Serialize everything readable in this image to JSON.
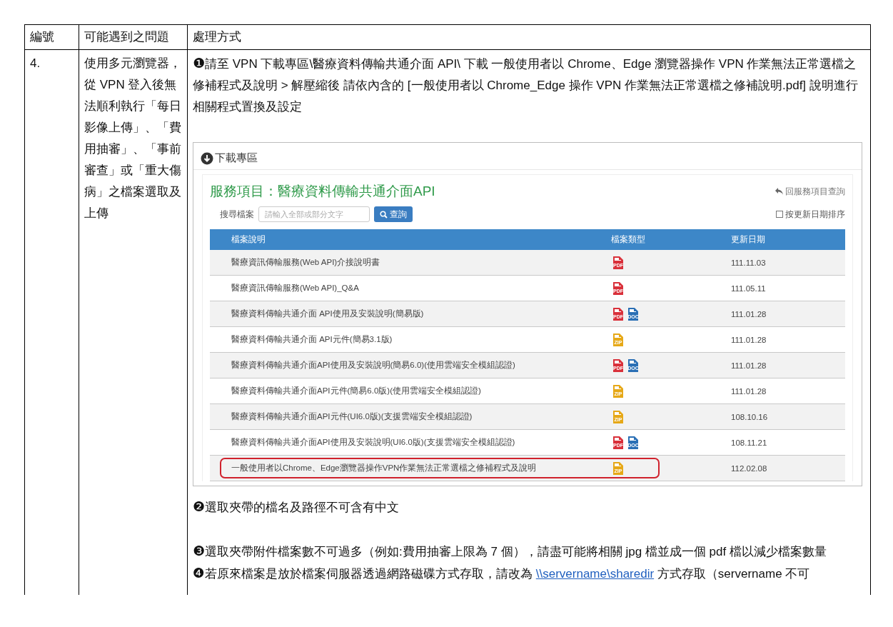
{
  "table": {
    "columns": [
      "編號",
      "可能遇到之問題",
      "處理方式"
    ],
    "rows": [
      {
        "number": "4.",
        "problem": "使用多元瀏覽器，從 VPN 登入後無法順利執行「每日影像上傳」、「費用抽審」、「事前審查」或「重大傷病」之檔案選取及上傳",
        "steps": [
          {
            "marker": "❶",
            "parts": [
              {
                "kind": "text",
                "text": "請至  VPN 下載專區\\醫療資料傳輸共通介面 API\\  下載  一般使用者以 Chrome、Edge 瀏覽器操作 VPN 作業無法正常選檔之修補程式及說明  >  解壓縮後  請依內含的  [一般使用者以 Chrome_Edge 操作 VPN 作業無法正常選檔之修補說明.pdf]  說明進行相關程式置換及設定"
              }
            ],
            "screenshot": {
              "section_title": "下載專區",
              "service_title": "服務項目：醫療資料傳輸共通介面API",
              "back_link": "回服務項目查詢",
              "search_label": "搜尋檔案",
              "search_placeholder": "請輸入全部或部分文字",
              "search_button": "查詢",
              "sort_option": {
                "label": "按更新日期排序",
                "checked": false
              },
              "columns": [
                "檔案說明",
                "檔案類型",
                "更新日期"
              ],
              "files": [
                {
                  "name": "醫療資訊傳輸服務(Web API)介接說明書",
                  "types": [
                    {
                      "kind": "pdf",
                      "label": "PDF"
                    }
                  ],
                  "date": "111.11.03",
                  "highlighted": false
                },
                {
                  "name": "醫療資訊傳輸服務(Web API)_Q&A",
                  "types": [
                    {
                      "kind": "pdf",
                      "label": "PDF"
                    }
                  ],
                  "date": "111.05.11",
                  "highlighted": false
                },
                {
                  "name": "醫療資料傳輸共通介面 API使用及安裝說明(簡易版)",
                  "types": [
                    {
                      "kind": "pdf",
                      "label": "PDF"
                    },
                    {
                      "kind": "doc",
                      "label": "DOC"
                    }
                  ],
                  "date": "111.01.28",
                  "highlighted": false
                },
                {
                  "name": "醫療資料傳輸共通介面 API元件(簡易3.1版)",
                  "types": [
                    {
                      "kind": "zip",
                      "label": "ZIP"
                    }
                  ],
                  "date": "111.01.28",
                  "highlighted": false
                },
                {
                  "name": "醫療資料傳輸共通介面API使用及安裝說明(簡易6.0)(使用雲端安全模組認證)",
                  "types": [
                    {
                      "kind": "pdf",
                      "label": "PDF"
                    },
                    {
                      "kind": "doc",
                      "label": "DOC"
                    }
                  ],
                  "date": "111.01.28",
                  "highlighted": false
                },
                {
                  "name": "醫療資料傳輸共通介面API元件(簡易6.0版)(使用雲端安全模組認證)",
                  "types": [
                    {
                      "kind": "zip",
                      "label": "ZIP"
                    }
                  ],
                  "date": "111.01.28",
                  "highlighted": false
                },
                {
                  "name": "醫療資料傳輸共通介面API元件(UI6.0版)(支援雲端安全模組認證)",
                  "types": [
                    {
                      "kind": "zip",
                      "label": "ZIP"
                    }
                  ],
                  "date": "108.10.16",
                  "highlighted": false
                },
                {
                  "name": "醫療資料傳輸共通介面API使用及安裝說明(UI6.0版)(支援雲端安全模組認證)",
                  "types": [
                    {
                      "kind": "pdf",
                      "label": "PDF"
                    },
                    {
                      "kind": "doc",
                      "label": "DOC"
                    }
                  ],
                  "date": "108.11.21",
                  "highlighted": false
                },
                {
                  "name": "一般使用者以Chrome、Edge瀏覽器操作VPN作業無法正常選檔之修補程式及說明",
                  "types": [
                    {
                      "kind": "zip",
                      "label": "ZIP"
                    }
                  ],
                  "date": "112.02.08",
                  "highlighted": true
                }
              ]
            }
          },
          {
            "marker": "❷",
            "parts": [
              {
                "kind": "text",
                "text": "選取夾帶的檔名及路徑不可含有中文"
              }
            ]
          },
          {
            "marker": "❸",
            "parts": [
              {
                "kind": "text",
                "text": "選取夾帶附件檔案數不可過多（例如:費用抽審上限為 7 個），請盡可能將相關 jpg 檔並成一個  pdf  檔以減少檔案數量"
              }
            ]
          },
          {
            "marker": "❹",
            "parts": [
              {
                "kind": "text",
                "text": "若原來檔案是放於檔案伺服器透過網路磁碟方式存取，請改為 "
              },
              {
                "kind": "link",
                "text": "\\\\servername\\sharedir"
              },
              {
                "kind": "text",
                "text": " 方式存取（servername 不可"
              }
            ]
          }
        ]
      }
    ]
  }
}
